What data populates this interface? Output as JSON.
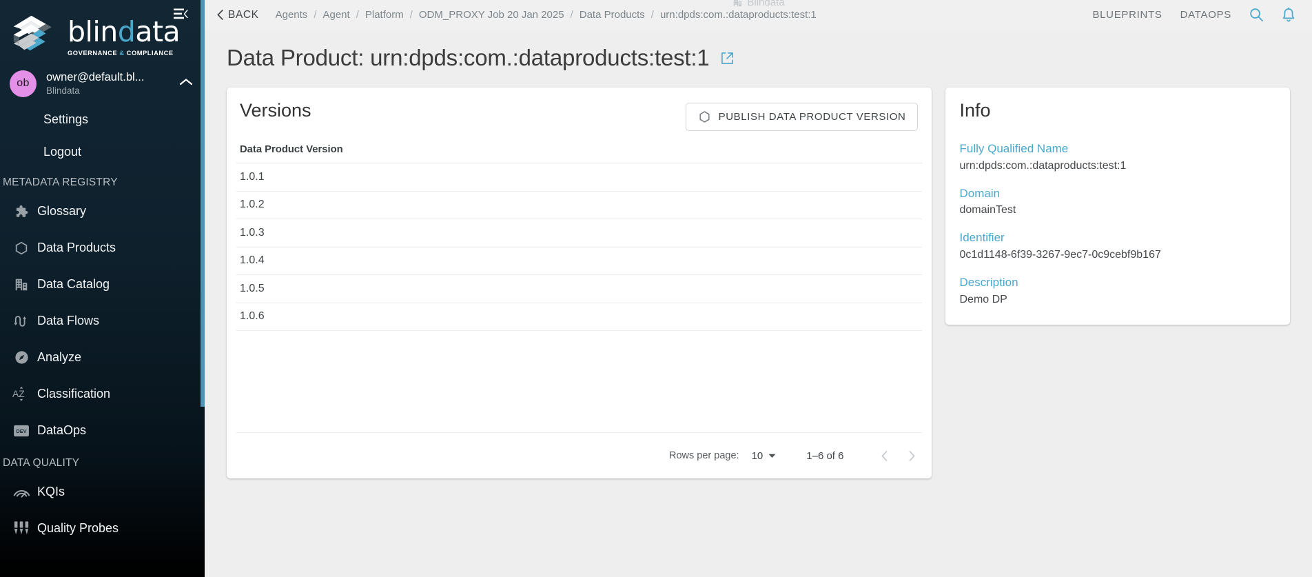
{
  "sidebar": {
    "logo": {
      "word_main": "blin",
      "word_accent": "d",
      "word_tail": "ata",
      "tagline_pre": "GOVERNANCE ",
      "tagline_amp": "&",
      "tagline_post": " COMPLIANCE"
    },
    "user": {
      "initials": "ob",
      "name": "owner@default.bl...",
      "org": "Blindata"
    },
    "account_links": [
      {
        "label": "Settings"
      },
      {
        "label": "Logout"
      }
    ],
    "sections": [
      {
        "title": "METADATA REGISTRY",
        "items": [
          {
            "label": "Glossary",
            "icon": "puzzle-icon"
          },
          {
            "label": "Data Products",
            "icon": "hexagon-icon"
          },
          {
            "label": "Data Catalog",
            "icon": "building-icon"
          },
          {
            "label": "Data Flows",
            "icon": "dataflow-icon"
          },
          {
            "label": "Analyze",
            "icon": "compass-icon"
          },
          {
            "label": "Classification",
            "icon": "sort-az-icon"
          },
          {
            "label": "DataOps",
            "icon": "dev-badge-icon"
          }
        ]
      },
      {
        "title": "DATA QUALITY",
        "items": [
          {
            "label": "KQIs",
            "icon": "gauge-icon"
          },
          {
            "label": "Quality Probes",
            "icon": "probes-icon"
          }
        ]
      }
    ]
  },
  "topbar": {
    "back_label": "BACK",
    "breadcrumbs": [
      {
        "label": "Agents"
      },
      {
        "label": "Agent"
      },
      {
        "label": "Platform"
      },
      {
        "label": "ODM_PROXY Job 20 Jan 2025"
      },
      {
        "label": "Data Products"
      },
      {
        "label": "urn:dpds:com.:dataproducts:test:1"
      }
    ],
    "separator": "/",
    "tenant": "Blindata",
    "links": [
      {
        "label": "BLUEPRINTS"
      },
      {
        "label": "DATAOPS"
      }
    ]
  },
  "page": {
    "title": "Data Product: urn:dpds:com.:dataproducts:test:1"
  },
  "versions": {
    "title": "Versions",
    "publish_label": "PUBLISH DATA PRODUCT VERSION",
    "column_header": "Data Product Version",
    "rows": [
      "1.0.1",
      "1.0.2",
      "1.0.3",
      "1.0.4",
      "1.0.5",
      "1.0.6"
    ],
    "pagination": {
      "rows_per_page_label": "Rows per page:",
      "rows_per_page_value": "10",
      "range_label": "1–6 of 6"
    }
  },
  "info": {
    "title": "Info",
    "fields": [
      {
        "label": "Fully Qualified Name",
        "value": "urn:dpds:com.:dataproducts:test:1"
      },
      {
        "label": "Domain",
        "value": "domainTest"
      },
      {
        "label": "Identifier",
        "value": "0c1d1148-6f39-3267-9ec7-0c9cebf9b167"
      },
      {
        "label": "Description",
        "value": "Demo DP"
      }
    ]
  },
  "colors": {
    "accent": "#4aa8cc",
    "sidebar_bg": "#0e202c",
    "avatar": "#e48fe8",
    "page_bg": "#eeeeee"
  }
}
